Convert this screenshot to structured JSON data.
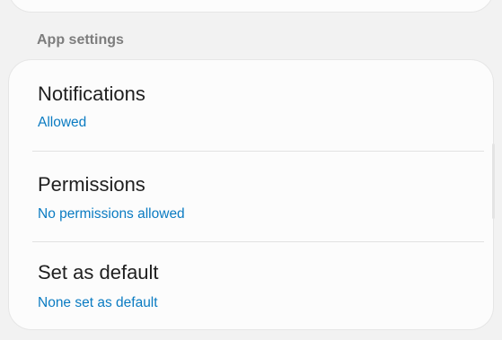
{
  "app_settings": {
    "section_title": "App settings",
    "items": [
      {
        "title": "Notifications",
        "subtitle": "Allowed"
      },
      {
        "title": "Permissions",
        "subtitle": "No permissions allowed"
      },
      {
        "title": "Set as default",
        "subtitle": "None set as default"
      }
    ]
  },
  "colors": {
    "background": "#f2f2f2",
    "card": "#fcfcfc",
    "accent": "#0a7bc2",
    "section_header": "#7d7d7d",
    "title_text": "#1f1f1f"
  }
}
